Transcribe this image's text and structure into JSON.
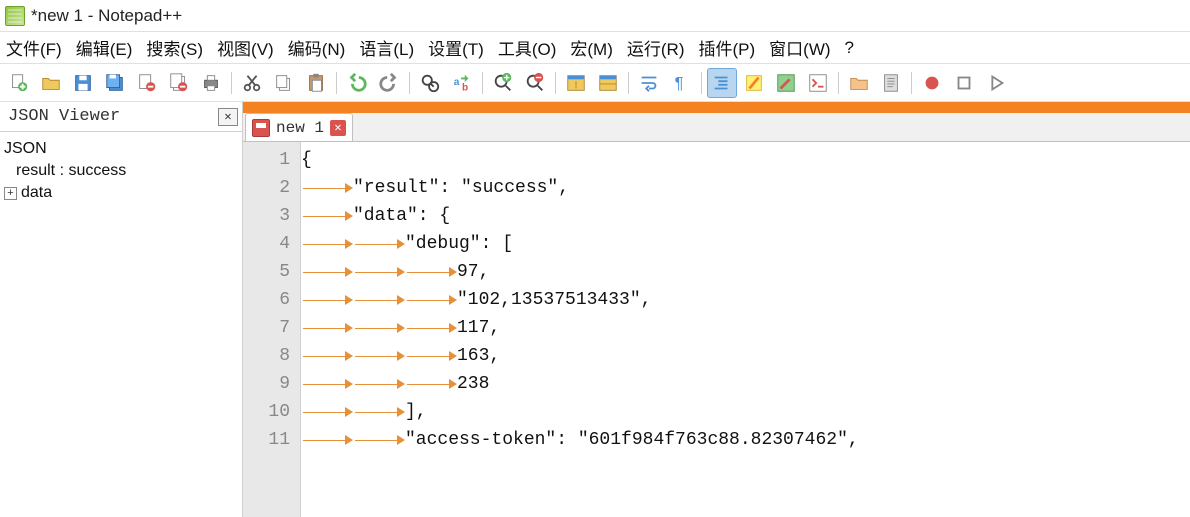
{
  "title": "*new 1 - Notepad++",
  "menu": [
    "文件(F)",
    "编辑(E)",
    "搜索(S)",
    "视图(V)",
    "编码(N)",
    "语言(L)",
    "设置(T)",
    "工具(O)",
    "宏(M)",
    "运行(R)",
    "插件(P)",
    "窗口(W)",
    "?"
  ],
  "toolbar_icons": [
    "new-file",
    "open-file",
    "save",
    "save-all",
    "close",
    "close-all",
    "print",
    "sep",
    "cut",
    "copy",
    "paste",
    "sep",
    "undo",
    "redo",
    "sep",
    "find",
    "find-replace",
    "sep",
    "zoom-in",
    "zoom-out",
    "sep",
    "sync-v",
    "sync-h",
    "sep",
    "word-wrap",
    "show-all-chars",
    "sep",
    "indent-guide",
    "highlight",
    "eyedrop",
    "function-list",
    "sep",
    "folder",
    "doc-map",
    "sep",
    "record",
    "stop",
    "play"
  ],
  "sidepanel": {
    "title": "JSON Viewer",
    "tree": [
      {
        "label": "JSON",
        "level": 0,
        "expander": ""
      },
      {
        "label": "result : success",
        "level": 1,
        "expander": ""
      },
      {
        "label": "data",
        "level": 1,
        "expander": "+"
      }
    ]
  },
  "tab": {
    "label": "new 1"
  },
  "lines": [
    {
      "n": 1,
      "indent": 0,
      "text": "{",
      "eolDot": false
    },
    {
      "n": 2,
      "indent": 1,
      "text": "\"result\": \"success\",",
      "eolDot": true
    },
    {
      "n": 3,
      "indent": 1,
      "text": "\"data\": {",
      "eolDot": true
    },
    {
      "n": 4,
      "indent": 2,
      "text": "\"debug\": [",
      "eolDot": true
    },
    {
      "n": 5,
      "indent": 3,
      "text": "97,",
      "eolDot": false
    },
    {
      "n": 6,
      "indent": 3,
      "text": "\"102,13537513433\",",
      "eolDot": false
    },
    {
      "n": 7,
      "indent": 3,
      "text": "117,",
      "eolDot": false
    },
    {
      "n": 8,
      "indent": 3,
      "text": "163,",
      "eolDot": false
    },
    {
      "n": 9,
      "indent": 3,
      "text": "238",
      "eolDot": false
    },
    {
      "n": 10,
      "indent": 2,
      "text": "],",
      "eolDot": false
    },
    {
      "n": 11,
      "indent": 2,
      "text": "\"access-token\": \"601f984f763c88.82307462\",",
      "eolDot": true
    }
  ]
}
